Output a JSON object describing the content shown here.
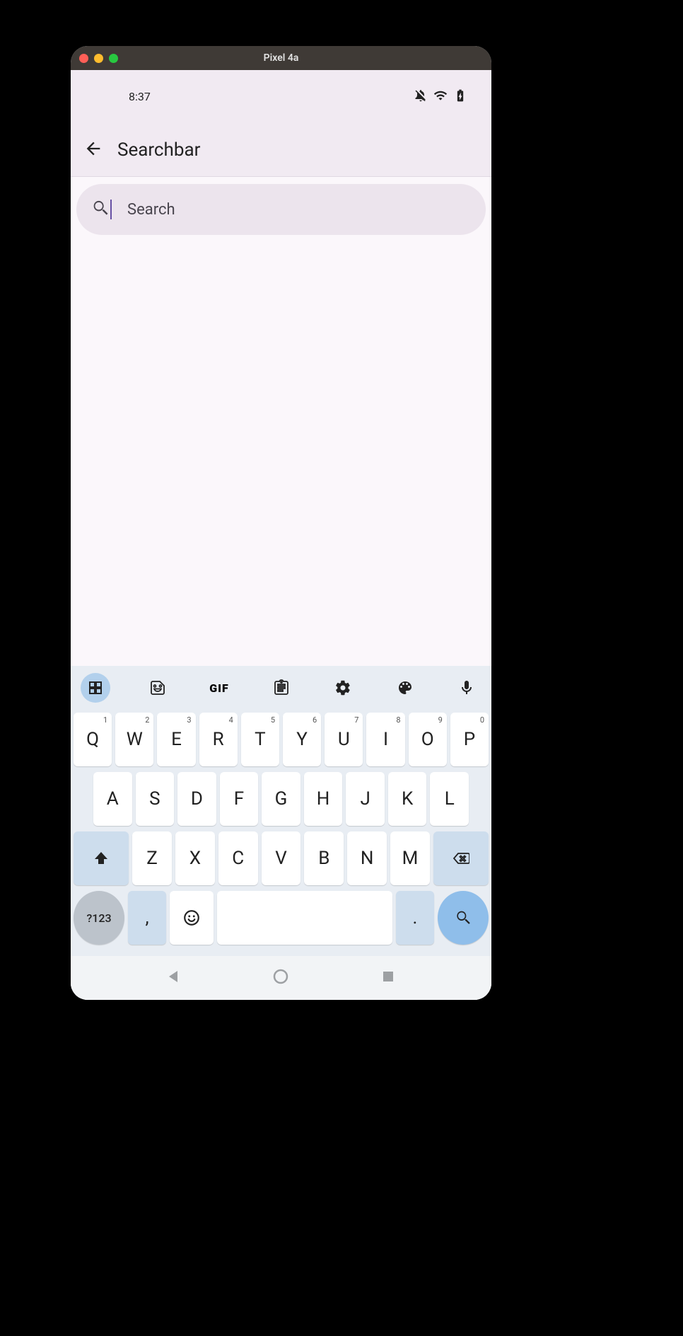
{
  "window_title": "Pixel 4a",
  "status": {
    "time": "8:37"
  },
  "appbar": {
    "title": "Searchbar"
  },
  "search": {
    "placeholder": "Search",
    "value": ""
  },
  "keyboard": {
    "toolbar": {
      "gif_label": "GIF"
    },
    "row1": [
      {
        "c": "Q",
        "n": "1"
      },
      {
        "c": "W",
        "n": "2"
      },
      {
        "c": "E",
        "n": "3"
      },
      {
        "c": "R",
        "n": "4"
      },
      {
        "c": "T",
        "n": "5"
      },
      {
        "c": "Y",
        "n": "6"
      },
      {
        "c": "U",
        "n": "7"
      },
      {
        "c": "I",
        "n": "8"
      },
      {
        "c": "O",
        "n": "9"
      },
      {
        "c": "P",
        "n": "0"
      }
    ],
    "row2": [
      "A",
      "S",
      "D",
      "F",
      "G",
      "H",
      "J",
      "K",
      "L"
    ],
    "row3": [
      "Z",
      "X",
      "C",
      "V",
      "B",
      "N",
      "M"
    ],
    "sym_label": "?123",
    "comma": ",",
    "period": "."
  }
}
